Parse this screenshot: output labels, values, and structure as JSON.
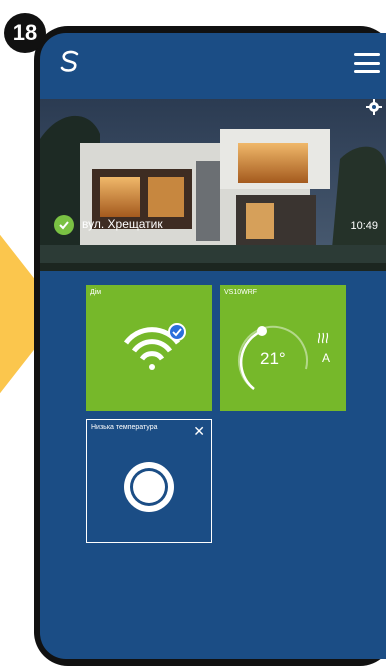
{
  "step_number": "18",
  "header": {
    "logo_icon": "salus-s-logo-icon",
    "menu_icon": "hamburger-menu-icon"
  },
  "location": {
    "address": "вул. Хрещатик",
    "time": "10:49",
    "status_icon": "check-circle-icon",
    "settings_icon": "gear-icon"
  },
  "tiles": [
    {
      "label": "Дім",
      "icon": "wifi-icon",
      "status": "connected"
    },
    {
      "label": "VS10WRF",
      "temperature": "21°",
      "mode": "A",
      "icon": "heating-icon"
    },
    {
      "label": "Низька температура",
      "close_icon": "close-icon",
      "icon": "ring-button-icon"
    }
  ],
  "colors": {
    "screen_bg": "#1b4d85",
    "tile_green": "#76b82a",
    "arrow_yellow": "#fbc64d",
    "badge_bg": "#111111",
    "check_green": "#7ac143",
    "wifi_check_blue": "#2a6fdb"
  }
}
